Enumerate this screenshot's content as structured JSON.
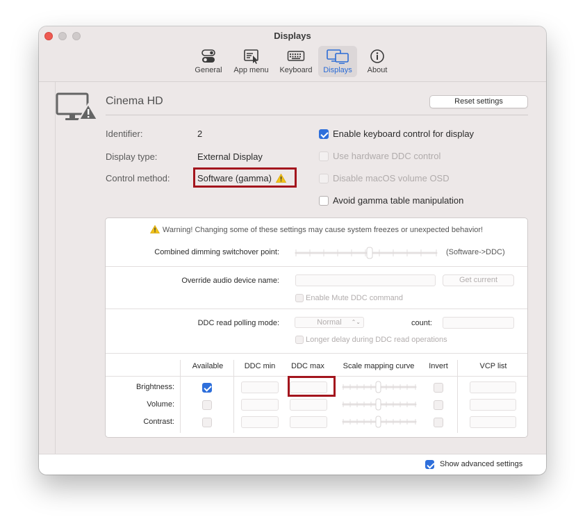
{
  "window": {
    "title": "Displays"
  },
  "toolbar": {
    "items": [
      {
        "label": "General",
        "icon": "toggles-icon"
      },
      {
        "label": "App menu",
        "icon": "app-menu-icon"
      },
      {
        "label": "Keyboard",
        "icon": "keyboard-icon"
      },
      {
        "label": "Displays",
        "icon": "displays-icon"
      },
      {
        "label": "About",
        "icon": "info-icon"
      }
    ],
    "active": "Displays"
  },
  "display": {
    "name": "Cinema HD",
    "reset_label": "Reset settings",
    "identifier_label": "Identifier:",
    "identifier_value": "2",
    "type_label": "Display type:",
    "type_value": "External Display",
    "method_label": "Control method:",
    "method_value": "Software (gamma)"
  },
  "options": {
    "keyboard_control": {
      "label": "Enable keyboard control for display",
      "checked": true
    },
    "hardware_ddc": {
      "label": "Use hardware DDC control",
      "checked": false
    },
    "disable_osd": {
      "label": "Disable macOS volume OSD",
      "checked": false
    },
    "avoid_gamma": {
      "label": "Avoid gamma table manipulation",
      "checked": false
    }
  },
  "advanced": {
    "warning": "Warning! Changing some of these settings may cause system freezes or unexpected behavior!",
    "switchover_label": "Combined dimming switchover point:",
    "switchover_suffix": "(Software->DDC)",
    "audio_label": "Override audio device name:",
    "get_current_label": "Get current",
    "mute_label": "Enable Mute DDC command",
    "polling_label": "DDC read polling mode:",
    "polling_value": "Normal",
    "count_label": "count:",
    "longer_delay_label": "Longer delay during DDC read operations",
    "table": {
      "headers": [
        "Available",
        "DDC min",
        "DDC max",
        "Scale mapping curve",
        "Invert",
        "VCP list"
      ],
      "rows": [
        {
          "label": "Brightness:",
          "available": true
        },
        {
          "label": "Volume:",
          "available": false
        },
        {
          "label": "Contrast:",
          "available": false
        }
      ]
    }
  },
  "footer": {
    "show_advanced_label": "Show advanced settings",
    "checked": true
  },
  "colors": {
    "accent": "#2e6fdb",
    "highlight": "#a3151d",
    "warning": "#f2c318"
  }
}
